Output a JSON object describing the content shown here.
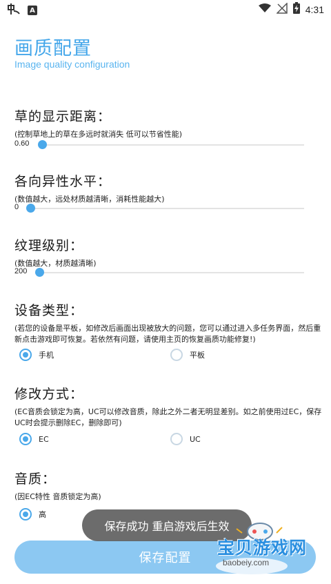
{
  "status_bar": {
    "time": "4:31",
    "icons": [
      "app-logo-icon",
      "a-notification-icon",
      "wifi-icon",
      "no-signal-icon",
      "battery-charging-icon"
    ],
    "a_icon_letter": "A"
  },
  "header": {
    "title": "画质配置",
    "subtitle": "Image quality configuration"
  },
  "sections": {
    "grass": {
      "title": "草的显示距离：",
      "desc": "(控制草地上的草在多远时就消失 低可以节省性能)",
      "slider_value": "0.60",
      "slider_fraction": 0.02
    },
    "aniso": {
      "title": "各向异性水平：",
      "desc": "(数值越大，远处材质越清晰，消耗性能越大)",
      "slider_value": "0",
      "slider_fraction": 0.0
    },
    "texture": {
      "title": "纹理级别：",
      "desc": "(数值越大，材质越清晰)",
      "slider_value": "200",
      "slider_fraction": 0.0
    },
    "device": {
      "title": "设备类型：",
      "desc": "(若您的设备是平板，如修改后画面出现被放大的问题，您可以通过进入多任务界面，然后重新点击游戏即可恢复。若依然有问题，请使用主页的恢复画质功能修复!)",
      "options": [
        "手机",
        "平板"
      ],
      "selected": "手机"
    },
    "mode": {
      "title": "修改方式：",
      "desc": "(EC音质会锁定为高，UC可以修改音质，除此之外二者无明显差别。如之前使用过EC，保存UC时会提示删除EC，删除即可)",
      "options": [
        "EC",
        "UC"
      ],
      "selected": "EC"
    },
    "audio": {
      "title": "音质：",
      "desc": "(因EC特性 音质锁定为高)",
      "options": [
        "高"
      ],
      "selected": "高"
    }
  },
  "save_button": {
    "label": "保存配置"
  },
  "toast": {
    "text": "保存成功 重启游戏后生效"
  },
  "watermark": {
    "text": "宝贝游戏网",
    "url": "baobeiy.com"
  },
  "colors": {
    "accent": "#4aa8ea",
    "button": "#8cc8f2",
    "toast": "#5f5f5f"
  }
}
